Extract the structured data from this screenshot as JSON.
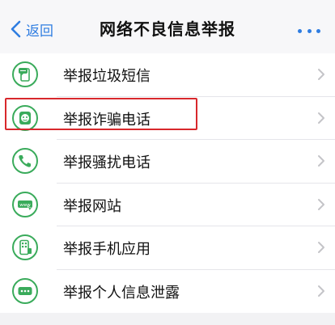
{
  "nav": {
    "back_label": "返回",
    "title": "网络不良信息举报"
  },
  "items": [
    {
      "label": "举报垃圾短信",
      "icon": "sms-phone-icon"
    },
    {
      "label": "举报诈骗电话",
      "icon": "fraud-call-icon"
    },
    {
      "label": "举报骚扰电话",
      "icon": "phone-icon"
    },
    {
      "label": "举报网站",
      "icon": "website-icon"
    },
    {
      "label": "举报手机应用",
      "icon": "mobile-app-icon"
    },
    {
      "label": "举报个人信息泄露",
      "icon": "message-dots-icon"
    }
  ],
  "colors": {
    "accent_blue": "#2f7de1",
    "icon_green": "#3aab5b",
    "highlight_red": "#d8282c"
  }
}
